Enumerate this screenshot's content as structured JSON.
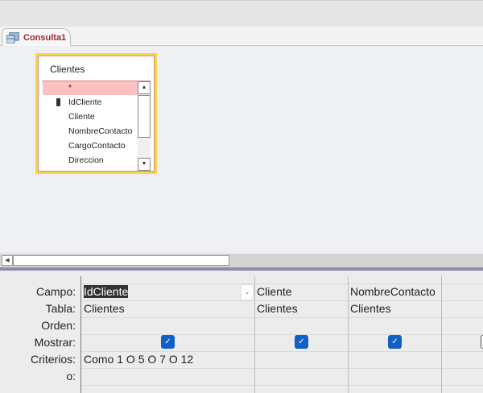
{
  "tab": {
    "label": "Consulta1"
  },
  "table": {
    "title": "Clientes",
    "fields": [
      "*",
      "IdCliente",
      "Cliente",
      "NombreContacto",
      "CargoContacto",
      "Direccion"
    ],
    "primary_key": "IdCliente"
  },
  "grid": {
    "row_labels": [
      "Campo:",
      "Tabla:",
      "Orden:",
      "Mostrar:",
      "Criterios:",
      "o:"
    ],
    "columns": [
      {
        "campo": "IdCliente",
        "tabla": "Clientes",
        "orden": "",
        "mostrar": true,
        "criterios": "Como 1 O 5 O 7 O 12"
      },
      {
        "campo": "Cliente",
        "tabla": "Clientes",
        "orden": "",
        "mostrar": true,
        "criterios": ""
      },
      {
        "campo": "NombreContacto",
        "tabla": "Clientes",
        "orden": "",
        "mostrar": true,
        "criterios": ""
      },
      {
        "campo": "",
        "tabla": "",
        "orden": "",
        "mostrar": false,
        "criterios": ""
      }
    ]
  },
  "colors": {
    "accent": "#a4262c",
    "checkbox": "#1160c6",
    "table_border": "#f7d54a"
  }
}
